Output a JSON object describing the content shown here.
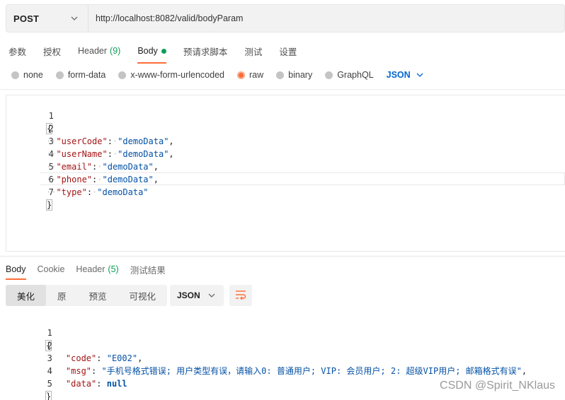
{
  "request": {
    "method": "POST",
    "url": "http://localhost:8082/valid/bodyParam"
  },
  "request_tabs": [
    {
      "label": "参数"
    },
    {
      "label": "授权"
    },
    {
      "label": "Header",
      "count": "(9)"
    },
    {
      "label": "Body"
    },
    {
      "label": "预请求脚本"
    },
    {
      "label": "测试"
    },
    {
      "label": "设置"
    }
  ],
  "body_types": {
    "none": "none",
    "form_data": "form-data",
    "urlencoded": "x-www-form-urlencoded",
    "raw": "raw",
    "binary": "binary",
    "graphql": "GraphQL",
    "format": "JSON"
  },
  "request_body": {
    "line_numbers": [
      "1",
      "2",
      "3",
      "4",
      "5",
      "6",
      "7"
    ],
    "open": "{",
    "close": "}",
    "fields": [
      {
        "key": "\"userCode\"",
        "value": "\"demoData\"",
        "sep": ","
      },
      {
        "key": "\"userName\"",
        "value": "\"demoData\"",
        "sep": ","
      },
      {
        "key": "\"email\"",
        "value": "\"demoData\"",
        "sep": ","
      },
      {
        "key": "\"phone\"",
        "value": "\"demoData\"",
        "sep": ","
      },
      {
        "key": "\"type\"",
        "value": "\"demoData\"",
        "sep": ""
      }
    ]
  },
  "response_tabs": [
    {
      "label": "Body"
    },
    {
      "label": "Cookie"
    },
    {
      "label": "Header",
      "count": "(5)"
    },
    {
      "label": "测试结果"
    }
  ],
  "response_views": [
    "美化",
    "原",
    "预览",
    "可视化"
  ],
  "response_format": "JSON",
  "response_body": {
    "line_numbers": [
      "1",
      "2",
      "3",
      "4",
      "5"
    ],
    "open": "{",
    "close": "}",
    "fields": [
      {
        "key": "\"code\"",
        "value": "\"E002\"",
        "sep": ","
      },
      {
        "key": "\"msg\"",
        "value": "\"手机号格式错误; 用户类型有误，请输入0: 普通用户; VIP: 会员用户; 2: 超级VIP用户; 邮箱格式有误\"",
        "sep": ","
      },
      {
        "key": "\"data\"",
        "value": "null",
        "sep": ""
      }
    ]
  },
  "watermark": "CSDN @Spirit_NKlaus",
  "colors": {
    "accent": "#ff6c37",
    "green_count": "#0f9d58",
    "json_link": "#0265d2",
    "json_key": "#a31515",
    "json_string": "#0451a5"
  }
}
